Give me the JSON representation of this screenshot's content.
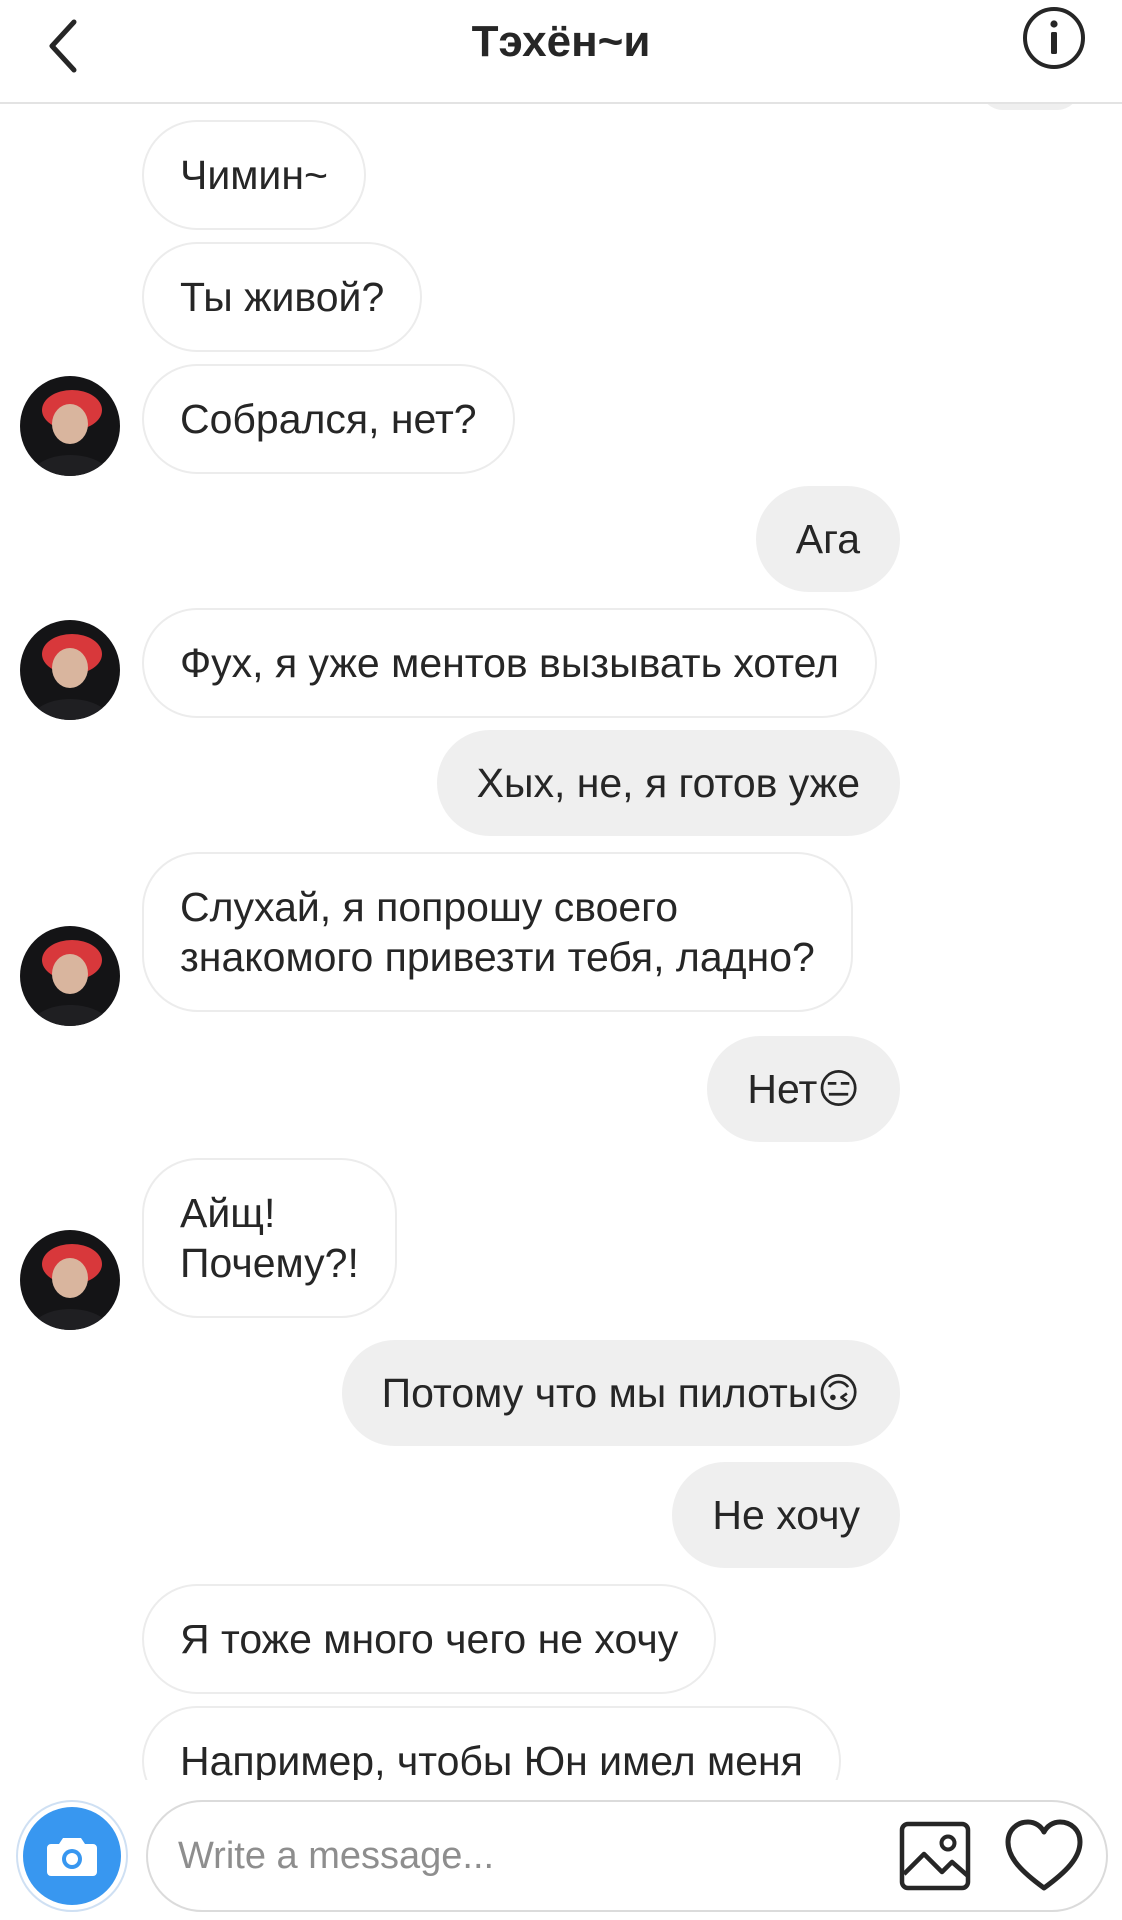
{
  "header": {
    "title": "Тэхён~и",
    "back_icon": "chevron-left-icon",
    "info_icon": "info-icon"
  },
  "messages": [
    {
      "side": "in",
      "text": "Чимин~"
    },
    {
      "side": "in",
      "text": "Ты живой?"
    },
    {
      "side": "in",
      "text": "Собрался, нет?"
    },
    {
      "side": "out",
      "text": "Ага"
    },
    {
      "side": "in",
      "text": "Фух, я уже ментов вызывать хотел"
    },
    {
      "side": "out",
      "text": "Хых, не, я готов уже"
    },
    {
      "side": "in",
      "text": "Слухай, я попрошу своего\nзнакомого привезти тебя, ладно?"
    },
    {
      "side": "out",
      "text": "Нет😑"
    },
    {
      "side": "in",
      "text": "Айщ!\nПочему?!"
    },
    {
      "side": "out",
      "text": "Потому что мы пилоты🙃"
    },
    {
      "side": "out",
      "text": "Не хочу"
    },
    {
      "side": "in",
      "text": "Я тоже много чего не хочу"
    },
    {
      "side": "in",
      "text": "Например, чтобы Юн имел меня"
    }
  ],
  "composer": {
    "placeholder": "Write a message...",
    "camera_icon": "camera-icon",
    "gallery_icon": "image-icon",
    "like_icon": "heart-icon"
  },
  "colors": {
    "accent": "#3897f0",
    "outgoing_bubble": "#efefef",
    "incoming_border": "#ececec",
    "text": "#262626",
    "placeholder": "#8e8e8e"
  }
}
